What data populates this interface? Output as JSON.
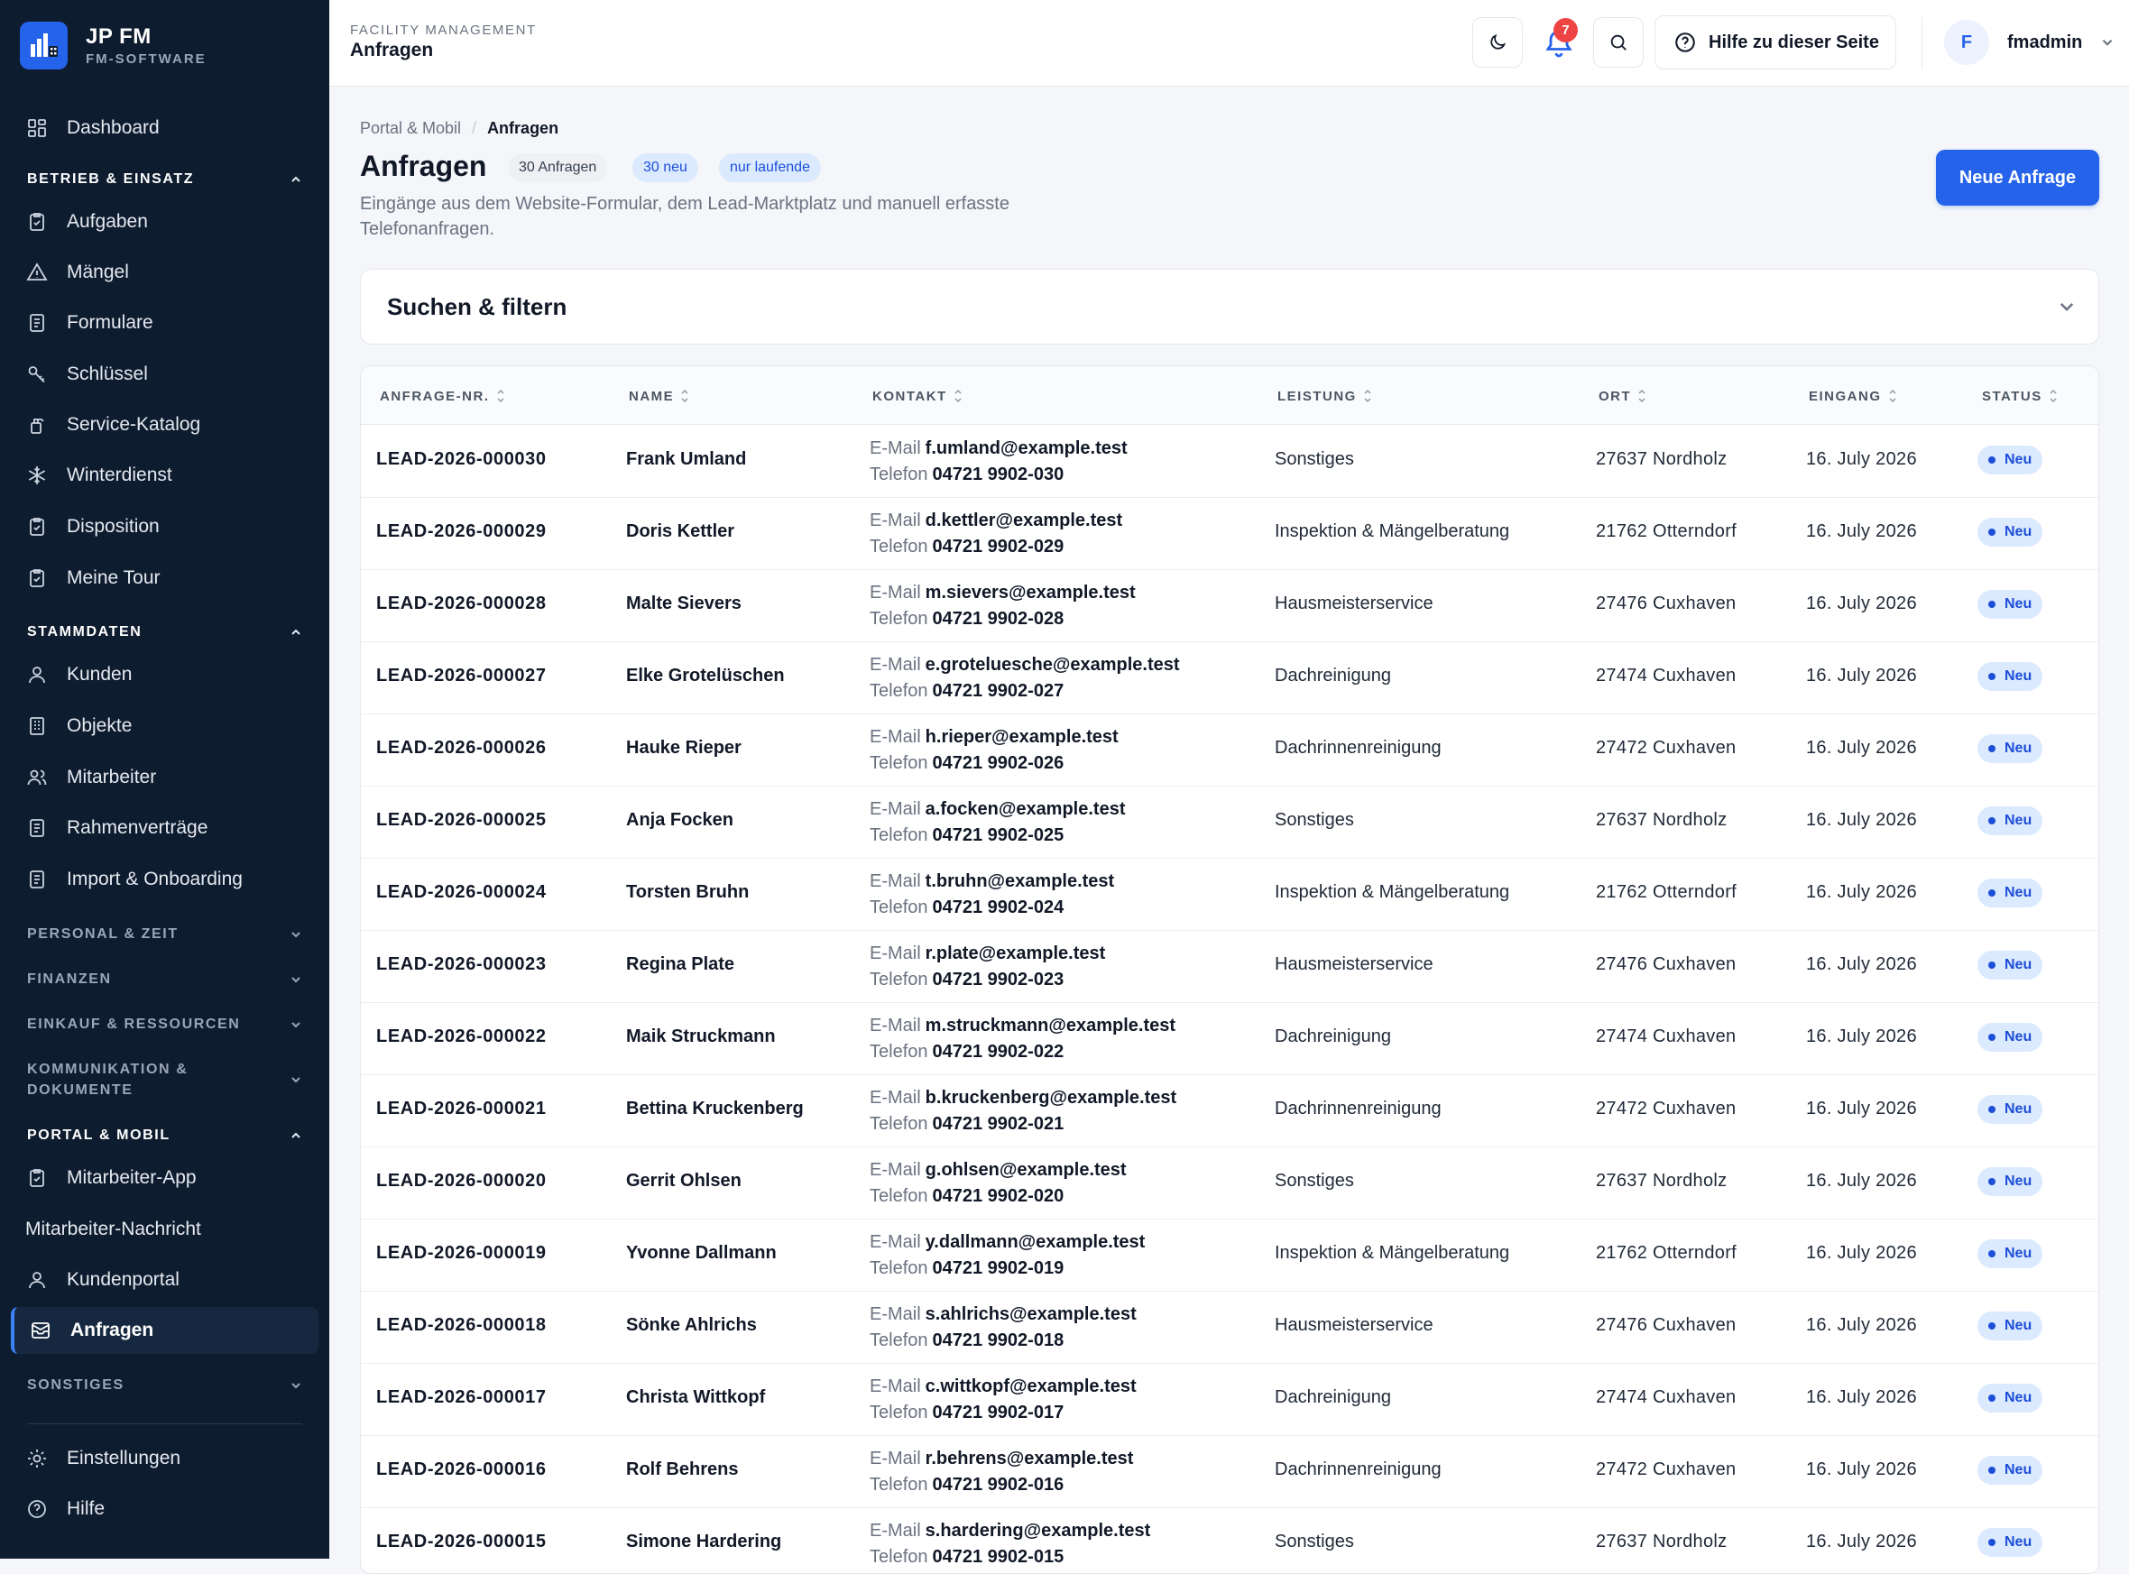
{
  "brand": {
    "title": "JP FM",
    "subtitle": "FM-SOFTWARE"
  },
  "sidebar": {
    "dashboard": "Dashboard",
    "sections": {
      "betrieb": "BETRIEB & EINSATZ",
      "stammdaten": "STAMMDATEN",
      "personal": "PERSONAL & ZEIT",
      "finanzen": "FINANZEN",
      "einkauf": "EINKAUF & RESSOURCEN",
      "kommunikation": "KOMMUNIKATION & DOKUMENTE",
      "portal": "PORTAL & MOBIL",
      "sonstiges": "SONSTIGES"
    },
    "betrieb_items": [
      "Aufgaben",
      "Mängel",
      "Formulare",
      "Schlüssel",
      "Service-Katalog",
      "Winterdienst",
      "Disposition",
      "Meine Tour"
    ],
    "stammdaten_items": [
      "Kunden",
      "Objekte",
      "Mitarbeiter",
      "Rahmenverträge",
      "Import & Onboarding"
    ],
    "portal_items": [
      "Mitarbeiter-App",
      "Mitarbeiter-Nachricht",
      "Kundenportal",
      "Anfragen"
    ],
    "bottom_items": [
      "Einstellungen",
      "Hilfe"
    ]
  },
  "header": {
    "section": "FACILITY MANAGEMENT",
    "title": "Anfragen",
    "notifications": "7",
    "help_label": "Hilfe zu dieser Seite",
    "user_initial": "F",
    "user_name": "fmadmin"
  },
  "page": {
    "breadcrumb": [
      "Portal & Mobil",
      "Anfragen"
    ],
    "title": "Anfragen",
    "pills": [
      "30 Anfragen",
      "30 neu",
      "nur laufende"
    ],
    "description": "Eingänge aus dem Website-Formular, dem Lead-Marktplatz und manuell erfasste Telefonanfragen.",
    "new_button": "Neue Anfrage",
    "filter_title": "Suchen & filtern"
  },
  "table": {
    "columns": [
      "ANFRAGE-NR.",
      "NAME",
      "KONTAKT",
      "LEISTUNG",
      "ORT",
      "EINGANG",
      "STATUS"
    ],
    "email_label": "E-Mail",
    "phone_label": "Telefon",
    "rows": [
      {
        "id": "LEAD-2026-000030",
        "name": "Frank Umland",
        "email": "f.umland@example.test",
        "phone": "04721 9902-030",
        "leistung": "Sonstiges",
        "ort": "27637 Nordholz",
        "eingang": "16. July 2026",
        "status": "Neu"
      },
      {
        "id": "LEAD-2026-000029",
        "name": "Doris Kettler",
        "email": "d.kettler@example.test",
        "phone": "04721 9902-029",
        "leistung": "Inspektion & Mängelberatung",
        "ort": "21762 Otterndorf",
        "eingang": "16. July 2026",
        "status": "Neu"
      },
      {
        "id": "LEAD-2026-000028",
        "name": "Malte Sievers",
        "email": "m.sievers@example.test",
        "phone": "04721 9902-028",
        "leistung": "Hausmeisterservice",
        "ort": "27476 Cuxhaven",
        "eingang": "16. July 2026",
        "status": "Neu"
      },
      {
        "id": "LEAD-2026-000027",
        "name": "Elke Grotelüschen",
        "email": "e.groteluesche@example.test",
        "phone": "04721 9902-027",
        "leistung": "Dachreinigung",
        "ort": "27474 Cuxhaven",
        "eingang": "16. July 2026",
        "status": "Neu"
      },
      {
        "id": "LEAD-2026-000026",
        "name": "Hauke Rieper",
        "email": "h.rieper@example.test",
        "phone": "04721 9902-026",
        "leistung": "Dachrinnenreinigung",
        "ort": "27472 Cuxhaven",
        "eingang": "16. July 2026",
        "status": "Neu"
      },
      {
        "id": "LEAD-2026-000025",
        "name": "Anja Focken",
        "email": "a.focken@example.test",
        "phone": "04721 9902-025",
        "leistung": "Sonstiges",
        "ort": "27637 Nordholz",
        "eingang": "16. July 2026",
        "status": "Neu"
      },
      {
        "id": "LEAD-2026-000024",
        "name": "Torsten Bruhn",
        "email": "t.bruhn@example.test",
        "phone": "04721 9902-024",
        "leistung": "Inspektion & Mängelberatung",
        "ort": "21762 Otterndorf",
        "eingang": "16. July 2026",
        "status": "Neu"
      },
      {
        "id": "LEAD-2026-000023",
        "name": "Regina Plate",
        "email": "r.plate@example.test",
        "phone": "04721 9902-023",
        "leistung": "Hausmeisterservice",
        "ort": "27476 Cuxhaven",
        "eingang": "16. July 2026",
        "status": "Neu"
      },
      {
        "id": "LEAD-2026-000022",
        "name": "Maik Struckmann",
        "email": "m.struckmann@example.test",
        "phone": "04721 9902-022",
        "leistung": "Dachreinigung",
        "ort": "27474 Cuxhaven",
        "eingang": "16. July 2026",
        "status": "Neu"
      },
      {
        "id": "LEAD-2026-000021",
        "name": "Bettina Kruckenberg",
        "email": "b.kruckenberg@example.test",
        "phone": "04721 9902-021",
        "leistung": "Dachrinnenreinigung",
        "ort": "27472 Cuxhaven",
        "eingang": "16. July 2026",
        "status": "Neu"
      },
      {
        "id": "LEAD-2026-000020",
        "name": "Gerrit Ohlsen",
        "email": "g.ohlsen@example.test",
        "phone": "04721 9902-020",
        "leistung": "Sonstiges",
        "ort": "27637 Nordholz",
        "eingang": "16. July 2026",
        "status": "Neu"
      },
      {
        "id": "LEAD-2026-000019",
        "name": "Yvonne Dallmann",
        "email": "y.dallmann@example.test",
        "phone": "04721 9902-019",
        "leistung": "Inspektion & Mängelberatung",
        "ort": "21762 Otterndorf",
        "eingang": "16. July 2026",
        "status": "Neu"
      },
      {
        "id": "LEAD-2026-000018",
        "name": "Sönke Ahlrichs",
        "email": "s.ahlrichs@example.test",
        "phone": "04721 9902-018",
        "leistung": "Hausmeisterservice",
        "ort": "27476 Cuxhaven",
        "eingang": "16. July 2026",
        "status": "Neu"
      },
      {
        "id": "LEAD-2026-000017",
        "name": "Christa Wittkopf",
        "email": "c.wittkopf@example.test",
        "phone": "04721 9902-017",
        "leistung": "Dachreinigung",
        "ort": "27474 Cuxhaven",
        "eingang": "16. July 2026",
        "status": "Neu"
      },
      {
        "id": "LEAD-2026-000016",
        "name": "Rolf Behrens",
        "email": "r.behrens@example.test",
        "phone": "04721 9902-016",
        "leistung": "Dachrinnenreinigung",
        "ort": "27472 Cuxhaven",
        "eingang": "16. July 2026",
        "status": "Neu"
      },
      {
        "id": "LEAD-2026-000015",
        "name": "Simone Hardering",
        "email": "s.hardering@example.test",
        "phone": "04721 9902-015",
        "leistung": "Sonstiges",
        "ort": "27637 Nordholz",
        "eingang": "16. July 2026",
        "status": "Neu"
      }
    ]
  },
  "colors": {
    "sidebar_bg": "#0e1c2f",
    "accent": "#2563eb",
    "badge": "#ef4444",
    "status_bg": "#dbeafe"
  }
}
